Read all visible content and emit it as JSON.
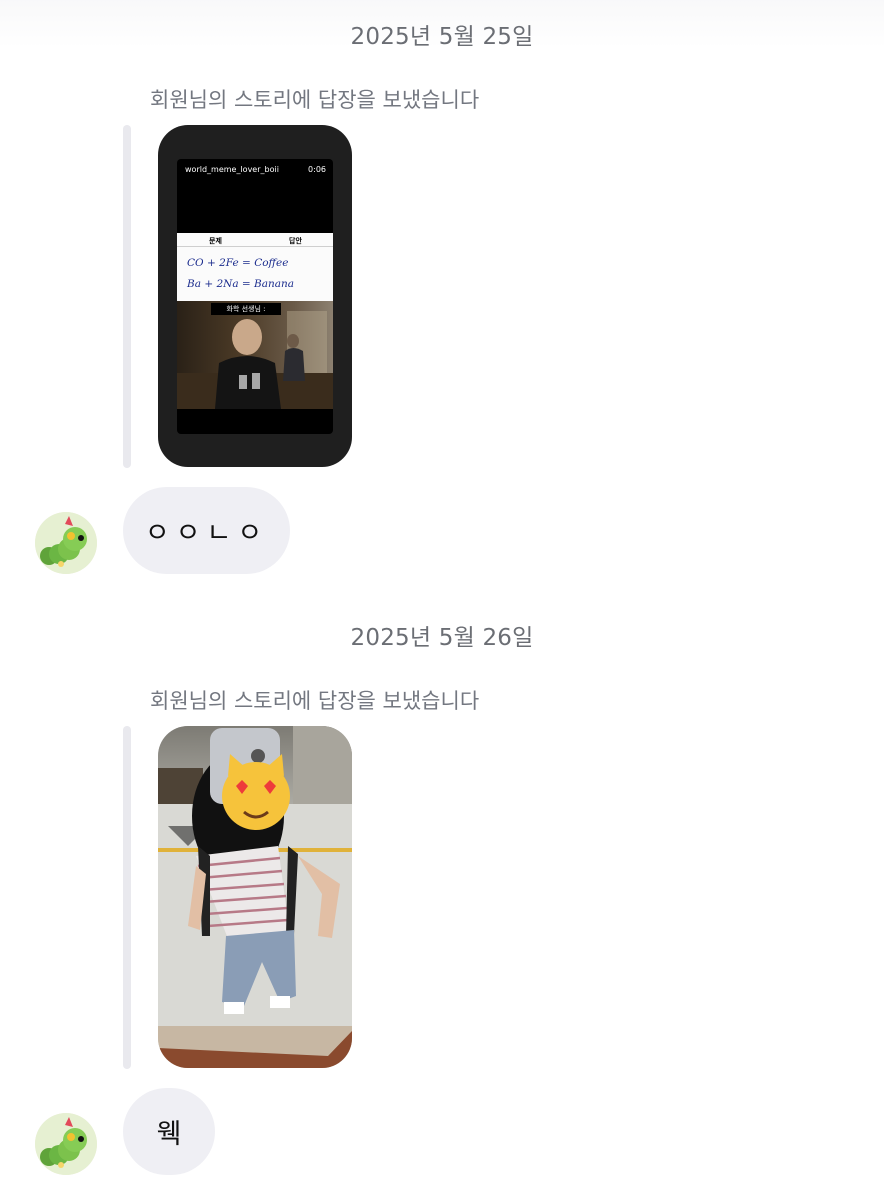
{
  "messages": [
    {
      "date": "2025년 5월 25일",
      "reply_label": "회원님의 스토리에 답장을 보냈습니다",
      "story": {
        "username": "world_meme_lover_boii",
        "duration": "0:06",
        "meme_col_left": "문제",
        "meme_col_right": "답안",
        "meme_line1": "CO + 2Fe  =  Coffee",
        "meme_line2": "Ba + 2Na  =  Banana",
        "meme_caption": "화학 선생님 :"
      },
      "text": "ㅇㅇㄴㅇ"
    },
    {
      "date": "2025년 5월 26일",
      "reply_label": "회원님의 스토리에 답장을 보냈습니다",
      "story": {},
      "text": "웩"
    }
  ],
  "colors": {
    "background": "#ffffff",
    "bubble": "#efeff4",
    "date_text": "#6b6e74",
    "reply_bar": "#e9e9ee"
  }
}
